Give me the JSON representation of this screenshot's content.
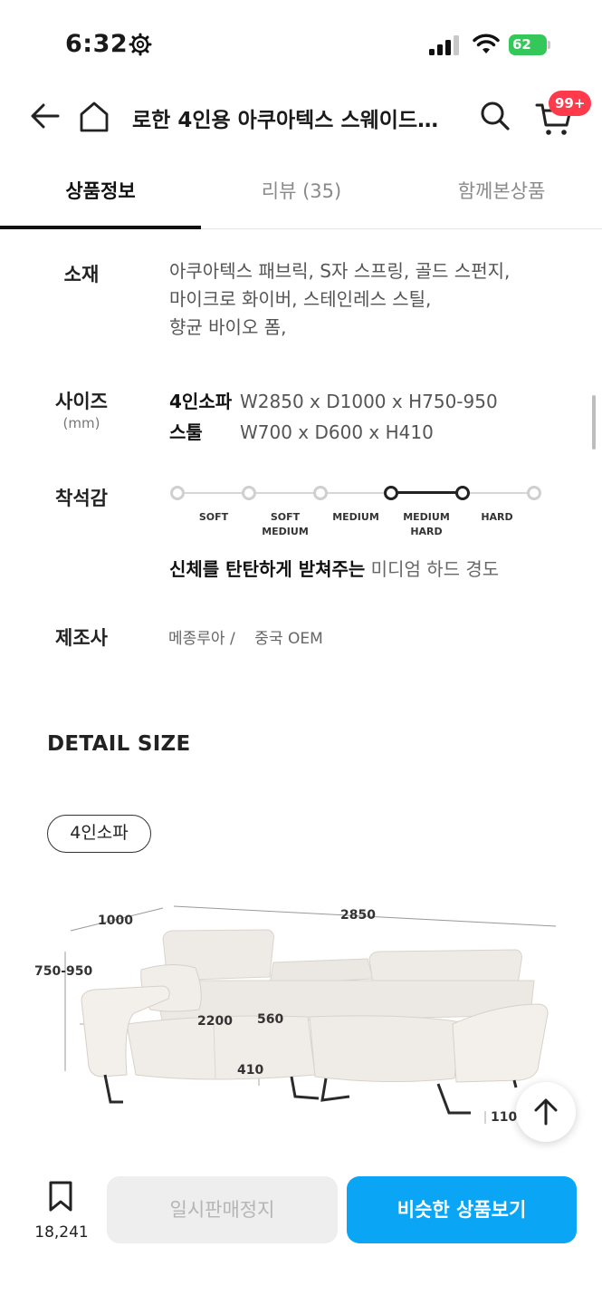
{
  "status_bar": {
    "time": "6:32",
    "battery": "62"
  },
  "header": {
    "title": "로한 4인용 아쿠아텍스 스웨이드…",
    "cart_badge": "99+"
  },
  "tabs": [
    {
      "label": "상품정보",
      "active": true
    },
    {
      "label": "리뷰 (35)",
      "active": false
    },
    {
      "label": "함께본상품",
      "active": false
    }
  ],
  "material": {
    "label": "소재",
    "lines": [
      "아쿠아텍스 패브릭, S자 스프링, 골드 스펀지,",
      "마이크로 화이버, 스테인레스 스틸,",
      "향균 바이오 폼,"
    ]
  },
  "size": {
    "label": "사이즈",
    "unit": "(mm)",
    "rows": [
      {
        "name": "4인소파",
        "value": "W2850 x D1000 x H750-950"
      },
      {
        "name": "스툴",
        "value": "W700 x D600 x H410"
      }
    ]
  },
  "firmness": {
    "label": "착석감",
    "levels": [
      "SOFT",
      "SOFT MEDIUM",
      "MEDIUM",
      "MEDIUM HARD",
      "HARD"
    ],
    "active_range": [
      3,
      4
    ],
    "caption_strong": "신체를 탄탄하게 받쳐주는",
    "caption_rest": " 미디엄 하드 경도"
  },
  "maker": {
    "label": "제조사",
    "value": "메종루아 /    중국 OEM"
  },
  "detail": {
    "title": "DETAIL SIZE",
    "chip": "4인소파",
    "dims": {
      "depth": "1000",
      "width": "2850",
      "height": "750-950",
      "seat_width": "2200",
      "seat_depth": "560",
      "seat_height": "410",
      "leg_height": "110"
    }
  },
  "bottom": {
    "wish_count": "18,241",
    "soldout_label": "일시판매정지",
    "similar_label": "비슷한 상품보기"
  }
}
